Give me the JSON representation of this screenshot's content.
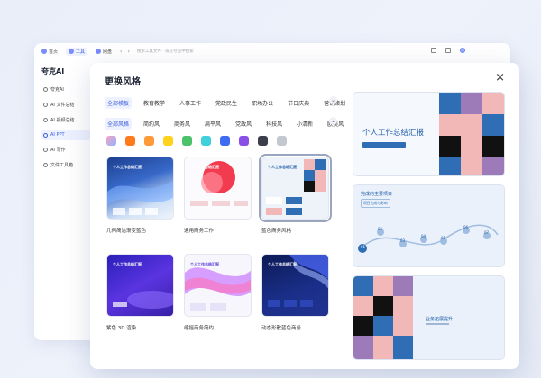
{
  "app": {
    "tabs": [
      {
        "label": "首页"
      },
      {
        "label": "工具"
      },
      {
        "label": "网盘"
      }
    ],
    "search_placeholder": "搜索工具文件 · 或在夸克中搜索",
    "brand": "夸克AI",
    "sidebar": [
      {
        "label": "夸克AI"
      },
      {
        "label": "AI 文件总结"
      },
      {
        "label": "AI 视频总结"
      },
      {
        "label": "AI PPT"
      },
      {
        "label": "AI 写作"
      },
      {
        "label": "文件工具箱"
      }
    ]
  },
  "modal": {
    "title": "更换风格",
    "close": "×",
    "more": "⌄",
    "categories_row1": [
      "全部模板",
      "教育教学",
      "人事工作",
      "党政民生",
      "职场办公",
      "节日庆典",
      "营销策划"
    ],
    "categories_row2": [
      "全部风格",
      "简约风",
      "商务风",
      "扁平风",
      "党政风",
      "科技风",
      "小清新",
      "欧美风"
    ],
    "colors": [
      "#f3a6c0",
      "#ff7a1a",
      "#ff9a3a",
      "#ffd21e",
      "#4cc36b",
      "#3fd0dc",
      "#3f6bf0",
      "#8a4fe8",
      "#3a3f4b",
      "#c3c7cf"
    ],
    "templates": [
      {
        "label": "几何简洁渐变蓝色",
        "title": "个人工作总结汇报"
      },
      {
        "label": "通用商务工作",
        "title": "个人工作总结汇报"
      },
      {
        "label": "蓝色商务风格",
        "title": "个人工作总结汇报"
      },
      {
        "label": "紫色 3D 渲染",
        "title": "个人工作总结汇报"
      },
      {
        "label": "缩摇商务简约",
        "title": "个人工作总结汇报"
      },
      {
        "label": "动态形散蓝色商务",
        "title": "个人工作总结汇报"
      }
    ],
    "preview": {
      "slide1_title": "个人工作总结汇报",
      "slide2_title": "完成的主要项目",
      "slide2_subtitle": "项目完成与影响",
      "slide2_steps": [
        "01",
        "02",
        "03",
        "04",
        "05",
        "06",
        "07"
      ],
      "slide3_title": "业务拓展提升"
    }
  }
}
